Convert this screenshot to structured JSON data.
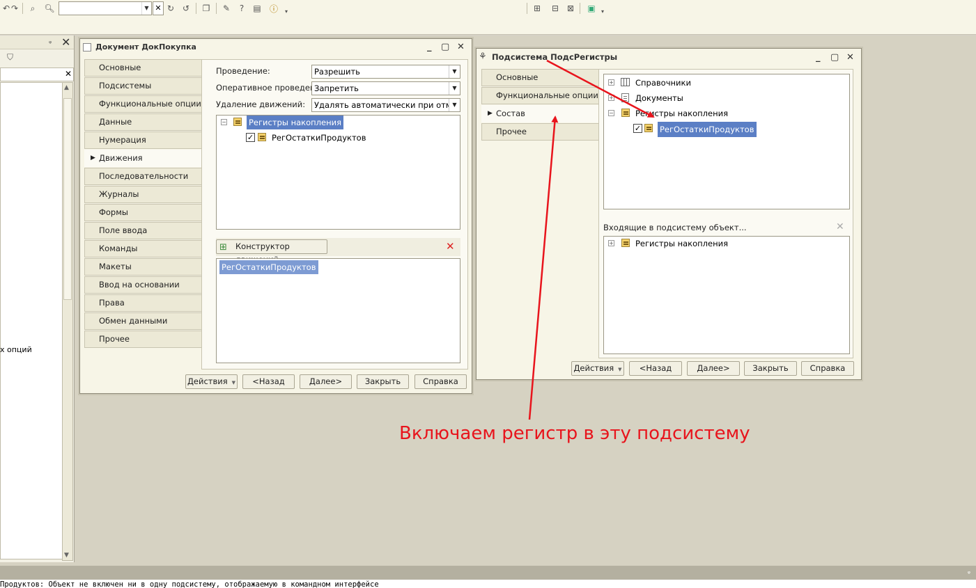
{
  "colors": {
    "annotation": "#e8141c",
    "selection": "#5b7fc5"
  },
  "toolbar": {
    "icons": [
      "undo-icon",
      "redo-icon",
      "find-icon",
      "search-icon",
      "find-next-icon",
      "find-prev-icon",
      "window-icon",
      "wizard-icon",
      "help-search-icon",
      "doc-icon",
      "info-icon",
      "layout-icon",
      "layout2-icon",
      "layout3-icon",
      "run-icon"
    ],
    "search_value": ""
  },
  "left_panel": {
    "partial_text": "х опций"
  },
  "doc_window": {
    "title": "Документ ДокПокупка",
    "tabs": [
      "Основные",
      "Подсистемы",
      "Функциональные опции",
      "Данные",
      "Нумерация",
      "Движения",
      "Последовательности",
      "Журналы",
      "Формы",
      "Поле ввода",
      "Команды",
      "Макеты",
      "Ввод на основании",
      "Права",
      "Обмен данными",
      "Прочее"
    ],
    "active_tab": "Движения",
    "posting_label": "Проведение:",
    "posting_value": "Разрешить",
    "realtime_label": "Оперативное проведен...",
    "realtime_value": "Запретить",
    "delete_label": "Удаление движений:",
    "delete_value": "Удалять автоматически при отмене",
    "tree_group": "Регистры накопления",
    "tree_item": "РегОстаткиПродуктов",
    "constructor_label": "Конструктор движений",
    "list_item": "РегОстаткиПродуктов",
    "buttons": {
      "actions": "Действия",
      "back": "<Назад",
      "next": "Далее>",
      "close": "Закрыть",
      "help": "Справка"
    }
  },
  "sub_window": {
    "title": "Подсистема ПодсРегистры",
    "tabs": [
      "Основные",
      "Функциональные опции",
      "Состав",
      "Прочее"
    ],
    "active_tab": "Состав",
    "tree": [
      "Справочники",
      "Документы",
      "Регистры накопления",
      "РегОстаткиПродуктов"
    ],
    "incoming_label": "Входящие в подсистему объект...",
    "incoming_item": "Регистры накопления",
    "buttons": {
      "actions": "Действия",
      "back": "<Назад",
      "next": "Далее>",
      "close": "Закрыть",
      "help": "Справка"
    }
  },
  "annotation": "Включаем регистр в эту подсистему",
  "message": "Продуктов: Объект не включен ни в одну подсистему, отображаемую в командном интерфейсе"
}
